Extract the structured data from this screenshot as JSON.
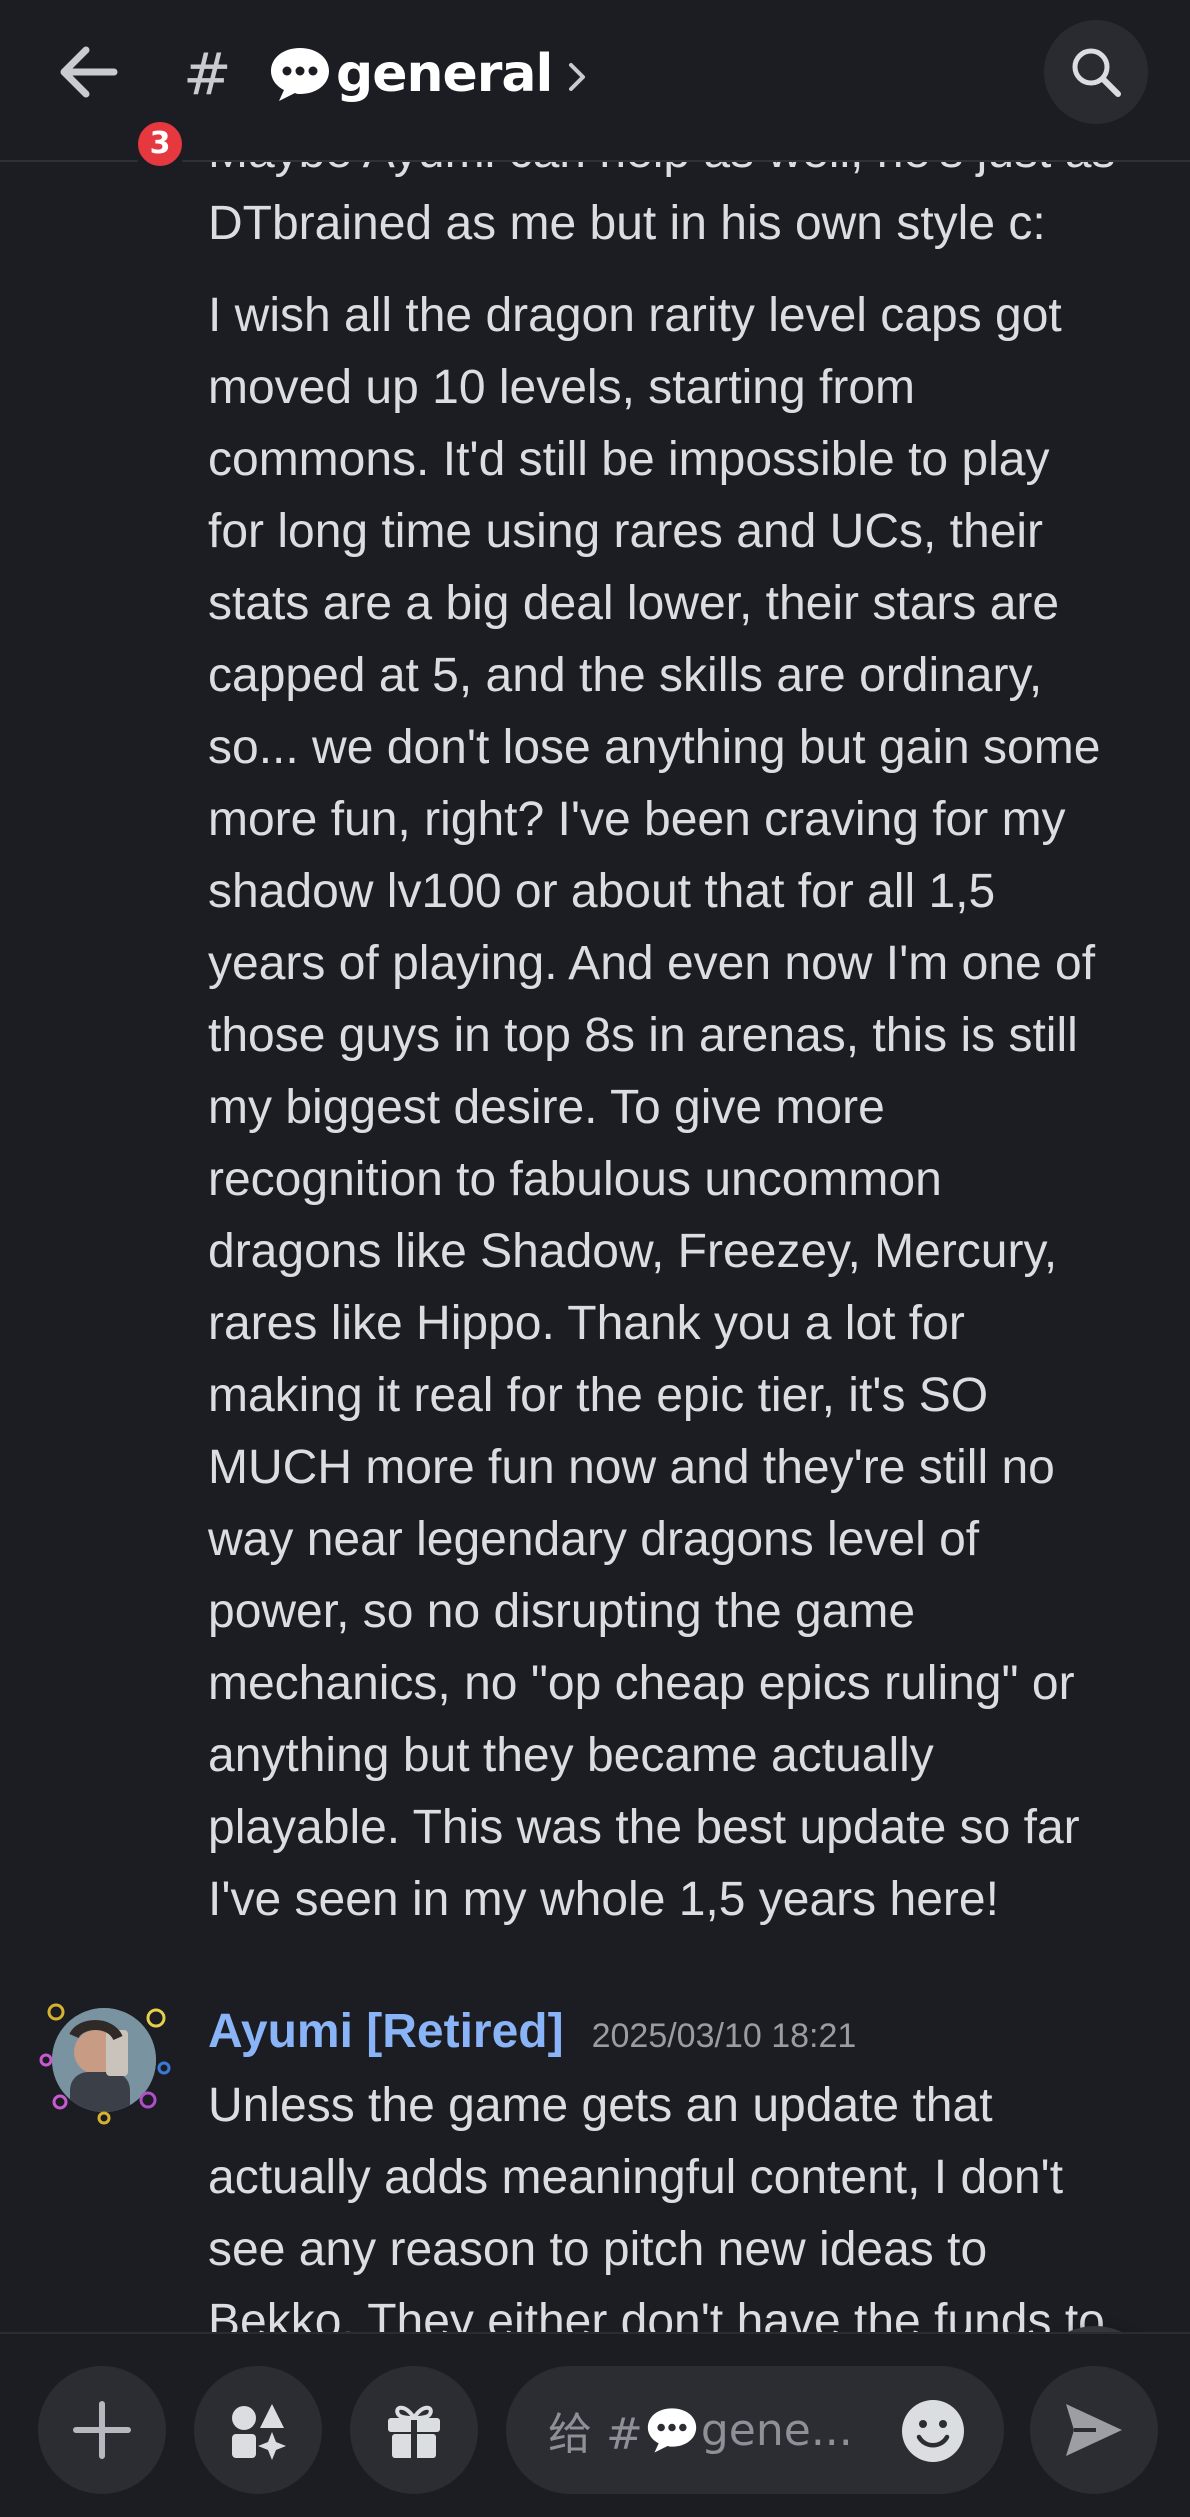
{
  "header": {
    "back_badge_count": "3",
    "channel_hash": "#",
    "channel_name": "general",
    "colors": {
      "background": "#1c1d22",
      "badge": "#e5383f",
      "text": "#ffffff"
    }
  },
  "messages": [
    {
      "id": "partial-top",
      "text": "Maybe Ayumi can help as well, he's just as\nDTbrained as me but in his own style c:"
    },
    {
      "id": "long",
      "text": "I wish all the dragon rarity level caps got\nmoved up 10 levels, starting from\ncommons. It'd still be impossible to play\nfor long time using rares and UCs, their\nstats are a big deal lower, their stars are\ncapped at 5, and the skills are ordinary,\nso... we don't lose anything but gain some\nmore fun, right? I've been craving for my\nshadow lv100 or about that for all 1,5\nyears of playing. And even now I'm one of\nthose guys in top 8s in arenas, this is still\nmy biggest desire. To give more\nrecognition to fabulous uncommon\ndragons like Shadow, Freezey, Mercury,\nrares like Hippo. Thank you a lot for\nmaking it real for the epic tier, it's SO\nMUCH more fun now and they're still no\nway near legendary dragons level of\npower, so no disrupting the game\nmechanics, no \"op cheap epics ruling\" or\nanything but they became actually\nplayable. This was the best update so far\nI've seen in my whole 1,5 years here!"
    },
    {
      "id": "reply",
      "author": "Ayumi [Retired]",
      "timestamp": "2025/03/10 18:21",
      "text": "Unless the game gets an update that\nactually adds meaningful content, I don't\nsee any reason to pitch new ideas to\nBekko. They either don't have the funds to"
    }
  ],
  "composer": {
    "placeholder_prefix": "给 #",
    "placeholder_suffix": "gene..."
  },
  "icons": {
    "back": "arrow-left-icon",
    "search": "search-icon",
    "scroll_down": "arrow-down-icon",
    "plus": "plus-icon",
    "apps": "apps-icon",
    "gift": "gift-icon",
    "emoji": "emoji-smile-icon",
    "send": "send-icon",
    "channel_emoji": "speech-bubble-emoji",
    "chevron": "chevron-right-icon"
  },
  "colors": {
    "author_name": "#8ab4f8",
    "timestamp": "#9a9ca3",
    "message_text": "#dbdee1",
    "button_bg": "#2b2d33"
  }
}
